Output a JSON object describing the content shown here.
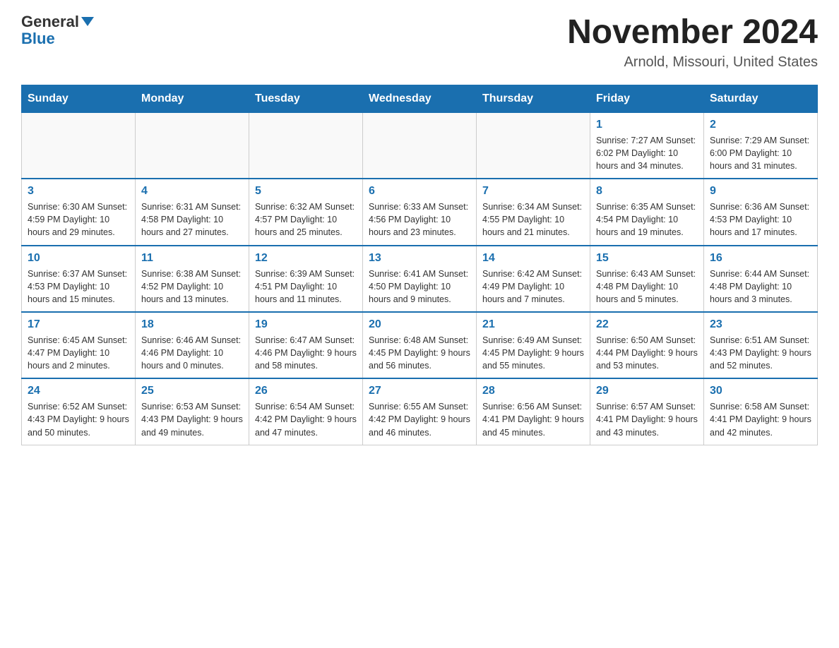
{
  "header": {
    "logo_general": "General",
    "logo_blue": "Blue",
    "title": "November 2024",
    "location": "Arnold, Missouri, United States"
  },
  "calendar": {
    "days_of_week": [
      "Sunday",
      "Monday",
      "Tuesday",
      "Wednesday",
      "Thursday",
      "Friday",
      "Saturday"
    ],
    "weeks": [
      [
        {
          "day": "",
          "info": ""
        },
        {
          "day": "",
          "info": ""
        },
        {
          "day": "",
          "info": ""
        },
        {
          "day": "",
          "info": ""
        },
        {
          "day": "",
          "info": ""
        },
        {
          "day": "1",
          "info": "Sunrise: 7:27 AM\nSunset: 6:02 PM\nDaylight: 10 hours\nand 34 minutes."
        },
        {
          "day": "2",
          "info": "Sunrise: 7:29 AM\nSunset: 6:00 PM\nDaylight: 10 hours\nand 31 minutes."
        }
      ],
      [
        {
          "day": "3",
          "info": "Sunrise: 6:30 AM\nSunset: 4:59 PM\nDaylight: 10 hours\nand 29 minutes."
        },
        {
          "day": "4",
          "info": "Sunrise: 6:31 AM\nSunset: 4:58 PM\nDaylight: 10 hours\nand 27 minutes."
        },
        {
          "day": "5",
          "info": "Sunrise: 6:32 AM\nSunset: 4:57 PM\nDaylight: 10 hours\nand 25 minutes."
        },
        {
          "day": "6",
          "info": "Sunrise: 6:33 AM\nSunset: 4:56 PM\nDaylight: 10 hours\nand 23 minutes."
        },
        {
          "day": "7",
          "info": "Sunrise: 6:34 AM\nSunset: 4:55 PM\nDaylight: 10 hours\nand 21 minutes."
        },
        {
          "day": "8",
          "info": "Sunrise: 6:35 AM\nSunset: 4:54 PM\nDaylight: 10 hours\nand 19 minutes."
        },
        {
          "day": "9",
          "info": "Sunrise: 6:36 AM\nSunset: 4:53 PM\nDaylight: 10 hours\nand 17 minutes."
        }
      ],
      [
        {
          "day": "10",
          "info": "Sunrise: 6:37 AM\nSunset: 4:53 PM\nDaylight: 10 hours\nand 15 minutes."
        },
        {
          "day": "11",
          "info": "Sunrise: 6:38 AM\nSunset: 4:52 PM\nDaylight: 10 hours\nand 13 minutes."
        },
        {
          "day": "12",
          "info": "Sunrise: 6:39 AM\nSunset: 4:51 PM\nDaylight: 10 hours\nand 11 minutes."
        },
        {
          "day": "13",
          "info": "Sunrise: 6:41 AM\nSunset: 4:50 PM\nDaylight: 10 hours\nand 9 minutes."
        },
        {
          "day": "14",
          "info": "Sunrise: 6:42 AM\nSunset: 4:49 PM\nDaylight: 10 hours\nand 7 minutes."
        },
        {
          "day": "15",
          "info": "Sunrise: 6:43 AM\nSunset: 4:48 PM\nDaylight: 10 hours\nand 5 minutes."
        },
        {
          "day": "16",
          "info": "Sunrise: 6:44 AM\nSunset: 4:48 PM\nDaylight: 10 hours\nand 3 minutes."
        }
      ],
      [
        {
          "day": "17",
          "info": "Sunrise: 6:45 AM\nSunset: 4:47 PM\nDaylight: 10 hours\nand 2 minutes."
        },
        {
          "day": "18",
          "info": "Sunrise: 6:46 AM\nSunset: 4:46 PM\nDaylight: 10 hours\nand 0 minutes."
        },
        {
          "day": "19",
          "info": "Sunrise: 6:47 AM\nSunset: 4:46 PM\nDaylight: 9 hours\nand 58 minutes."
        },
        {
          "day": "20",
          "info": "Sunrise: 6:48 AM\nSunset: 4:45 PM\nDaylight: 9 hours\nand 56 minutes."
        },
        {
          "day": "21",
          "info": "Sunrise: 6:49 AM\nSunset: 4:45 PM\nDaylight: 9 hours\nand 55 minutes."
        },
        {
          "day": "22",
          "info": "Sunrise: 6:50 AM\nSunset: 4:44 PM\nDaylight: 9 hours\nand 53 minutes."
        },
        {
          "day": "23",
          "info": "Sunrise: 6:51 AM\nSunset: 4:43 PM\nDaylight: 9 hours\nand 52 minutes."
        }
      ],
      [
        {
          "day": "24",
          "info": "Sunrise: 6:52 AM\nSunset: 4:43 PM\nDaylight: 9 hours\nand 50 minutes."
        },
        {
          "day": "25",
          "info": "Sunrise: 6:53 AM\nSunset: 4:43 PM\nDaylight: 9 hours\nand 49 minutes."
        },
        {
          "day": "26",
          "info": "Sunrise: 6:54 AM\nSunset: 4:42 PM\nDaylight: 9 hours\nand 47 minutes."
        },
        {
          "day": "27",
          "info": "Sunrise: 6:55 AM\nSunset: 4:42 PM\nDaylight: 9 hours\nand 46 minutes."
        },
        {
          "day": "28",
          "info": "Sunrise: 6:56 AM\nSunset: 4:41 PM\nDaylight: 9 hours\nand 45 minutes."
        },
        {
          "day": "29",
          "info": "Sunrise: 6:57 AM\nSunset: 4:41 PM\nDaylight: 9 hours\nand 43 minutes."
        },
        {
          "day": "30",
          "info": "Sunrise: 6:58 AM\nSunset: 4:41 PM\nDaylight: 9 hours\nand 42 minutes."
        }
      ]
    ]
  }
}
